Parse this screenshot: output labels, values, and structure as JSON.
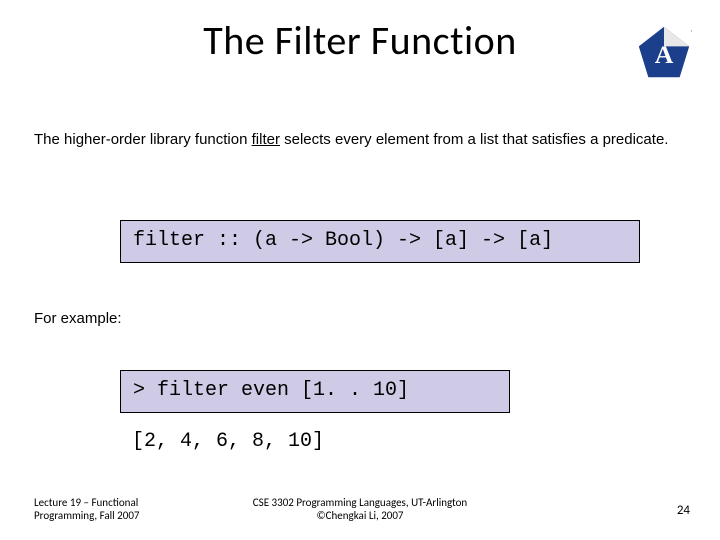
{
  "title": "The Filter Function",
  "intro_pre": "The higher-order library function ",
  "intro_underlined": "filter",
  "intro_post": " selects every element from a list that satisfies a predicate.",
  "signature": "filter :: (a -> Bool) -> [a] -> [a]",
  "example_label": "For example:",
  "example_code": "> filter even [1. . 10]",
  "example_result": "[2, 4, 6, 8, 10]",
  "footer_left_line1": "Lecture 19 – Functional",
  "footer_left_line2": "Programming, Fall 2007",
  "footer_center_line1": "CSE 3302 Programming Languages, UT-Arlington",
  "footer_center_line2": "©Chengkai Li, 2007",
  "page_number": "24"
}
